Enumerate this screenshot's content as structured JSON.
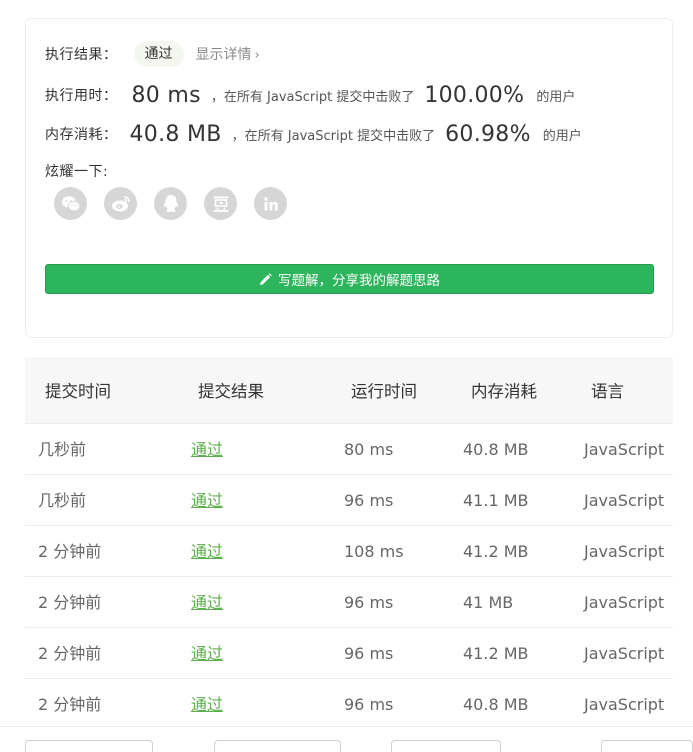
{
  "result": {
    "label": "执行结果：",
    "status": "通过",
    "detail_link": "显示详情",
    "detail_chevron": "›"
  },
  "runtime": {
    "label": "执行用时：",
    "value": "80 ms",
    "middle": "，在所有 JavaScript 提交中击败了",
    "percent": "100.00%",
    "suffix": "的用户"
  },
  "memory": {
    "label": "内存消耗：",
    "value": "40.8 MB",
    "middle": "，在所有 JavaScript 提交中击败了",
    "percent": "60.98%",
    "suffix": "的用户"
  },
  "share": {
    "label": "炫耀一下:",
    "icons": [
      "wechat-icon",
      "weibo-icon",
      "qq-icon",
      "douban-icon",
      "linkedin-icon"
    ]
  },
  "solution_button": "写题解，分享我的解题思路",
  "table": {
    "headers": [
      "提交时间",
      "提交结果",
      "运行时间",
      "内存消耗",
      "语言"
    ],
    "rows": [
      [
        "几秒前",
        "通过",
        "80 ms",
        "40.8 MB",
        "JavaScript"
      ],
      [
        "几秒前",
        "通过",
        "96 ms",
        "41.1 MB",
        "JavaScript"
      ],
      [
        "2 分钟前",
        "通过",
        "108 ms",
        "41.2 MB",
        "JavaScript"
      ],
      [
        "2 分钟前",
        "通过",
        "96 ms",
        "41 MB",
        "JavaScript"
      ],
      [
        "2 分钟前",
        "通过",
        "96 ms",
        "41.2 MB",
        "JavaScript"
      ],
      [
        "2 分钟前",
        "通过",
        "96 ms",
        "40.8 MB",
        "JavaScript"
      ]
    ]
  },
  "colors": {
    "accent_green": "#2db55d",
    "status_green": "#5cb04b",
    "share_gray": "#d6d6d6"
  }
}
